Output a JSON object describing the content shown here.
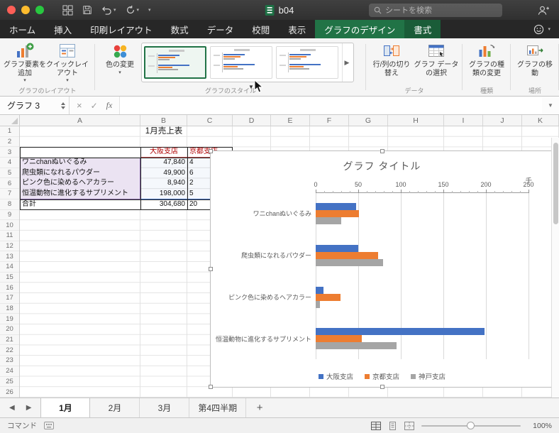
{
  "titlebar": {
    "title": "b04",
    "search_placeholder": "シートを検索"
  },
  "ribbon_tabs": [
    {
      "label": "ホーム",
      "state": "normal"
    },
    {
      "label": "挿入",
      "state": "normal"
    },
    {
      "label": "印刷レイアウト",
      "state": "normal"
    },
    {
      "label": "数式",
      "state": "normal"
    },
    {
      "label": "データ",
      "state": "normal"
    },
    {
      "label": "校閲",
      "state": "normal"
    },
    {
      "label": "表示",
      "state": "normal"
    },
    {
      "label": "グラフのデザイン",
      "state": "active"
    },
    {
      "label": "書式",
      "state": "contextual"
    }
  ],
  "ribbon": {
    "add_chart_element": "グラフ要素を追加",
    "quick_layout": "クイックレイアウト",
    "change_colors": "色の変更",
    "switch_row_col": "行/列の切り替え",
    "select_data": "グラフ データの選択",
    "change_chart_type": "グラフの種類の変更",
    "move_chart": "グラフの移動",
    "groups": {
      "layout": "グラフのレイアウト",
      "styles": "グラフのスタイル",
      "data": "データ",
      "type": "種類",
      "location": "場所"
    }
  },
  "formula_bar": {
    "name_box": "グラフ 3",
    "fx_label": "fx"
  },
  "sheet": {
    "column_headers": [
      "A",
      "B",
      "C",
      "D",
      "E",
      "F",
      "G",
      "H",
      "I",
      "J",
      "K"
    ],
    "row_count": 26,
    "title_cell": "1月売上表",
    "table": {
      "header_osaka": "大阪支店",
      "header_kyoto": "京都支店",
      "rows": [
        {
          "item": "ワニchanぬいぐるみ",
          "osaka": "47,840",
          "kyoto_visible": "4"
        },
        {
          "item": "爬虫類になれるパウダー",
          "osaka": "49,900",
          "kyoto_visible": "6"
        },
        {
          "item": "ピンク色に染めるヘアカラー",
          "osaka": "8,940",
          "kyoto_visible": "2"
        },
        {
          "item": "恒温動物に進化するサプリメント",
          "osaka": "198,000",
          "kyoto_visible": "5"
        }
      ],
      "total_row": {
        "item": "合計",
        "osaka": "304,680",
        "kyoto_visible": "20"
      }
    }
  },
  "chart_data": {
    "type": "bar",
    "orientation": "horizontal",
    "title": "グラフ タイトル",
    "axis_unit_label": "千",
    "x_ticks": [
      0,
      50,
      100,
      150,
      200,
      250
    ],
    "xlim": [
      0,
      250
    ],
    "grid": true,
    "legend_position": "bottom",
    "categories": [
      "ワニchanぬいぐるみ",
      "爬虫類になれるパウダー",
      "ピンク色に染めるヘアカラー",
      "恒温動物に進化するサプリメント"
    ],
    "series": [
      {
        "name": "大阪支店",
        "color": "#4472C4",
        "values": [
          47.8,
          49.9,
          8.9,
          198
        ]
      },
      {
        "name": "京都支店",
        "color": "#ED7D31",
        "values": [
          51,
          73,
          29,
          54
        ]
      },
      {
        "name": "神戸支店",
        "color": "#A5A5A5",
        "values": [
          30,
          79,
          5,
          95
        ]
      }
    ]
  },
  "sheet_tabs": {
    "tabs": [
      {
        "label": "1月",
        "active": true
      },
      {
        "label": "2月",
        "active": false
      },
      {
        "label": "3月",
        "active": false
      },
      {
        "label": "第4四半期",
        "active": false
      }
    ],
    "add_label": "+"
  },
  "status_bar": {
    "mode_label": "コマンド",
    "zoom_value": "100%"
  }
}
